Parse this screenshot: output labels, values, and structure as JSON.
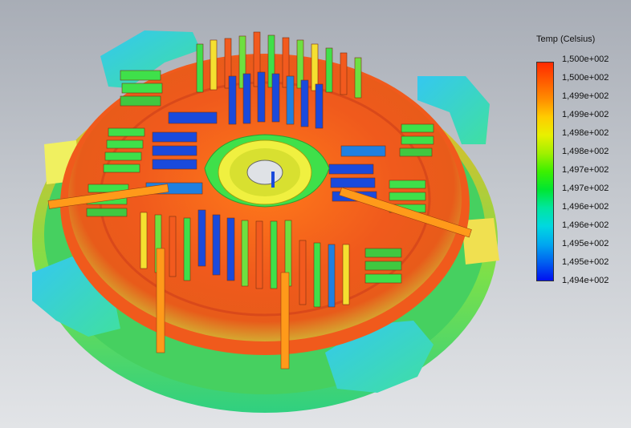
{
  "legend": {
    "title": "Temp (Celsius)",
    "ticks": [
      "1,500e+002",
      "1,500e+002",
      "1,499e+002",
      "1,499e+002",
      "1,498e+002",
      "1,498e+002",
      "1,497e+002",
      "1,497e+002",
      "1,496e+002",
      "1,496e+002",
      "1,495e+002",
      "1,495e+002",
      "1,494e+002"
    ],
    "colors": [
      "#ff2a00",
      "#ff5a00",
      "#ff8c00",
      "#ffcc00",
      "#e8f000",
      "#a0f000",
      "#3cf000",
      "#00e632",
      "#00e6a0",
      "#00d8e0",
      "#00a8f0",
      "#0060f0",
      "#0010f0"
    ]
  },
  "model": {
    "hot_color": "#f25a1e",
    "warm_color": "#ff9a1a",
    "cool_color": "#38c8e8",
    "green_color": "#3fe04a",
    "blue_color": "#1a4adc",
    "hub_color": "#f0f040"
  }
}
